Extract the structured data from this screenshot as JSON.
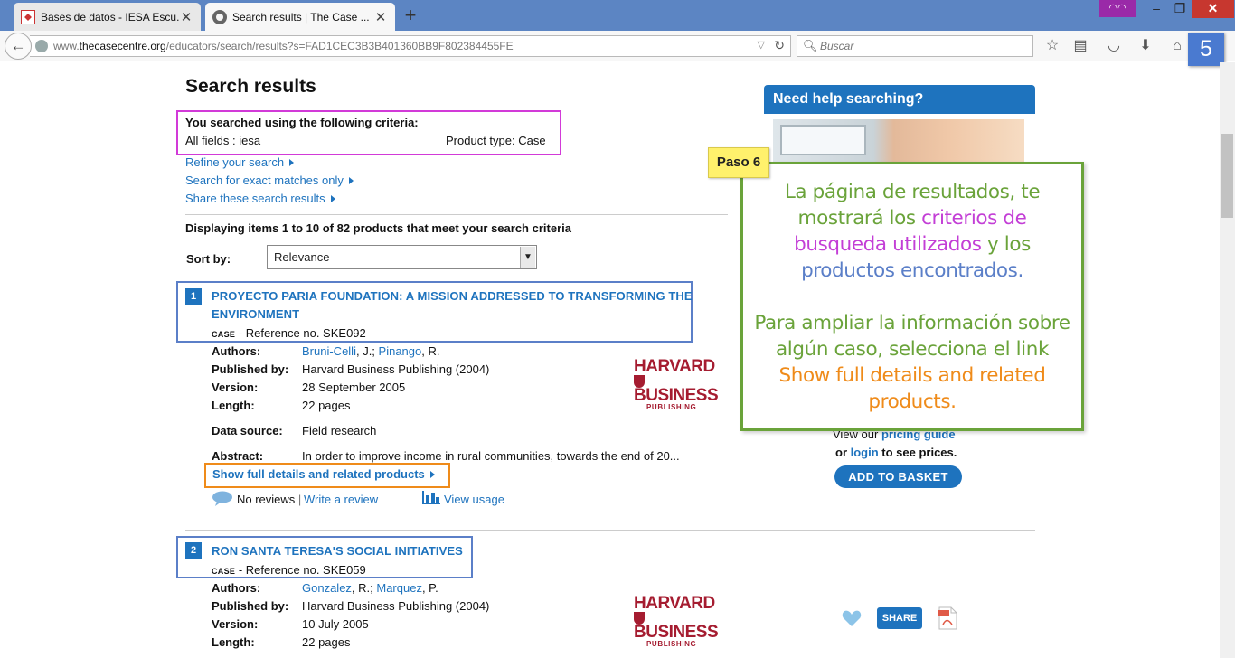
{
  "browser": {
    "tabs": [
      {
        "title": "Bases de datos - IESA Escu...",
        "active": false
      },
      {
        "title": "Search results | The Case ...",
        "active": true
      }
    ],
    "new_tab": "+",
    "url_prefix": "www.",
    "url_host": "thecasecentre.org",
    "url_path": "/educators/search/results?s=FAD1CEC3B3B401360BB9F802384455FE",
    "search_placeholder": "Buscar",
    "step_number": "5"
  },
  "page": {
    "title": "Search results",
    "criteria_heading": "You searched using the following criteria:",
    "criteria_fields": "All fields : iesa",
    "criteria_product": "Product type: Case",
    "links": {
      "refine": "Refine your search",
      "exact": "Search for exact matches only",
      "share": "Share these search results"
    },
    "displaying": "Displaying items 1 to 10 of 82 products that meet your search criteria",
    "sort_label": "Sort by:",
    "sort_value": "Relevance"
  },
  "results": [
    {
      "number": "1",
      "title_line1": "PROYECTO PARIA FOUNDATION: A MISSION ADDRESSED TO TRANSFORMING THE",
      "title_line2": "ENVIRONMENT",
      "type": "CASE",
      "reference": "Reference no. SKE092",
      "authors_label": "Authors:",
      "author1": "Bruni-Celli",
      "author1_init": ", J.; ",
      "author2": "Pinango",
      "author2_init": ", R.",
      "published_label": "Published by:",
      "published": "Harvard Business Publishing (2004)",
      "version_label": "Version:",
      "version": "28 September 2005",
      "length_label": "Length:",
      "length": "22 pages",
      "datasource_label": "Data source:",
      "datasource": "Field research",
      "abstract_label": "Abstract:",
      "abstract": "In order to improve income in rural communities, towards the end of 20...",
      "details_link": "Show full details and related products",
      "reviews": "No reviews",
      "separator": "|",
      "write_review": "Write a review",
      "view_usage": "View usage"
    },
    {
      "number": "2",
      "title_line1": "RON SANTA TERESA'S SOCIAL INITIATIVES",
      "type": "CASE",
      "reference": "Reference no. SKE059",
      "authors_label": "Authors:",
      "author1": "Gonzalez",
      "author1_init": ", R.; ",
      "author2": "Marquez",
      "author2_init": ", P.",
      "published_label": "Published by:",
      "published": "Harvard Business Publishing (2004)",
      "version_label": "Version:",
      "version": "10 July 2005",
      "length_label": "Length:",
      "length": "22 pages"
    }
  ],
  "publisher_logo": {
    "line1": "HARVARD",
    "line2": "BUSINESS",
    "line3": "PUBLISHING"
  },
  "sidebar": {
    "help_title": "Need help searching?",
    "pricing_pre": "View our ",
    "pricing_link": "pricing guide",
    "login_pre": "or ",
    "login_link": "login",
    "login_post": " to see prices.",
    "add_basket": "ADD TO BASKET",
    "share": "SHARE"
  },
  "annotation": {
    "tag": "Paso 6",
    "p1_a": "La página de resultados, te mostrará los ",
    "p1_b": "criterios de busqueda utilizados",
    "p1_c": " y los ",
    "p1_d": "productos encontrados",
    "p1_e": ".",
    "p2_a": "Para ampliar la información sobre algún caso, selecciona el link ",
    "p2_b": "Show full details and related products",
    "p2_c": "."
  },
  "colors": {
    "link_blue": "#1e73be",
    "annotation_green": "#6aa33a",
    "highlight_magenta": "#d23ad8",
    "highlight_blue": "#5b7fc8",
    "highlight_orange": "#ef8b1a",
    "harvard_red": "#a51c30"
  }
}
